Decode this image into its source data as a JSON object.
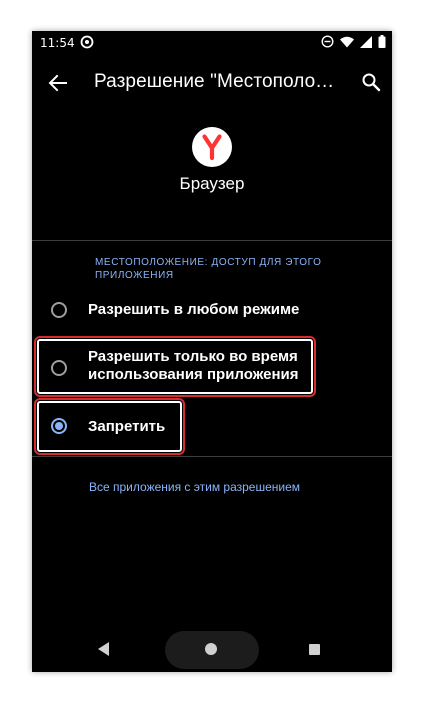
{
  "status_bar": {
    "time": "11:54",
    "icons": [
      "app-notification-icon",
      "do-not-disturb-icon",
      "wifi-icon",
      "signal-icon",
      "battery-icon"
    ]
  },
  "app_bar": {
    "title": "Разрешение \"Местоположе...",
    "back_icon": "arrow-back-icon",
    "search_icon": "search-icon"
  },
  "app": {
    "name": "Браузер",
    "logo_letter": "Y",
    "logo_color": "#ff3333"
  },
  "section": {
    "header": "МЕСТОПОЛОЖЕНИЕ: ДОСТУП ДЛЯ ЭТОГО ПРИЛОЖЕНИЯ"
  },
  "options": [
    {
      "label": "Разрешить в любом режиме",
      "selected": false
    },
    {
      "label": "Разрешить только во время использования приложения",
      "selected": false,
      "highlighted": true
    },
    {
      "label": "Запретить",
      "selected": true,
      "highlighted": true
    }
  ],
  "footer_link": "Все приложения с этим разрешением",
  "colors": {
    "accent": "#8ab4f8",
    "highlight_border": "#d32f2f",
    "background": "#000000"
  }
}
